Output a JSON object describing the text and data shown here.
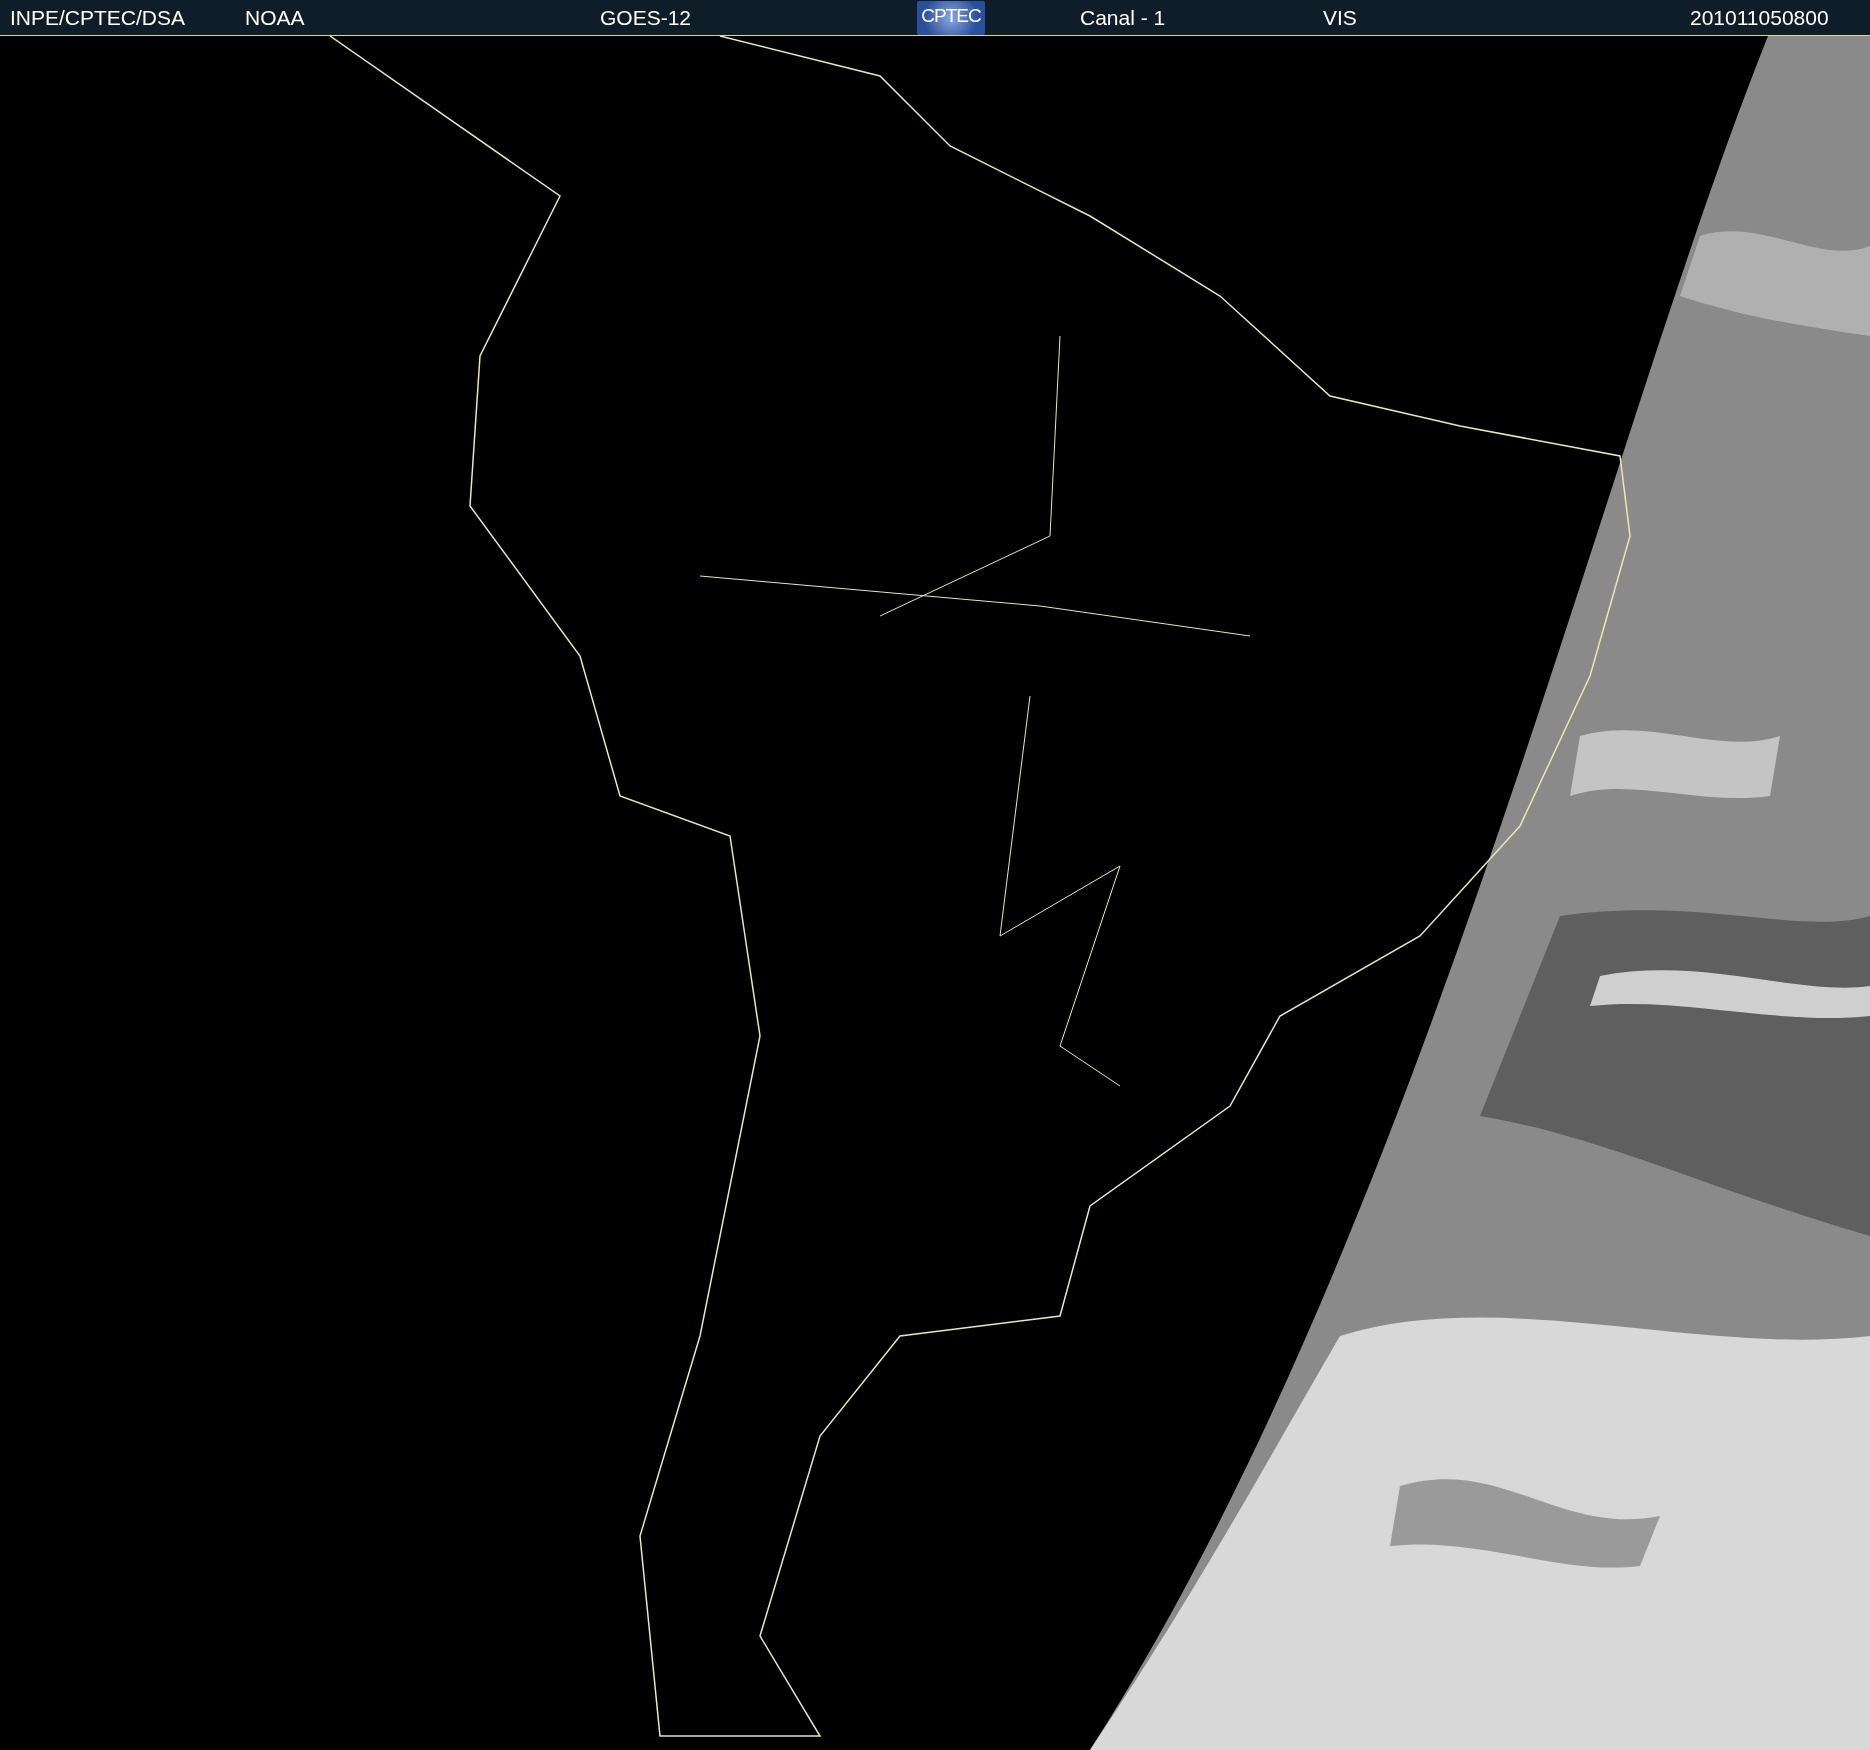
{
  "header": {
    "items": [
      {
        "kind": "text",
        "text": "INPE/CPTEC/DSA"
      },
      {
        "kind": "text",
        "text": "NOAA"
      },
      {
        "kind": "text",
        "text": "GOES-12"
      },
      {
        "kind": "logo",
        "text": "CPTEC"
      },
      {
        "kind": "text",
        "text": "Canal - 1"
      },
      {
        "kind": "text",
        "text": "VIS"
      },
      {
        "kind": "text",
        "text": "201011050800"
      }
    ]
  }
}
